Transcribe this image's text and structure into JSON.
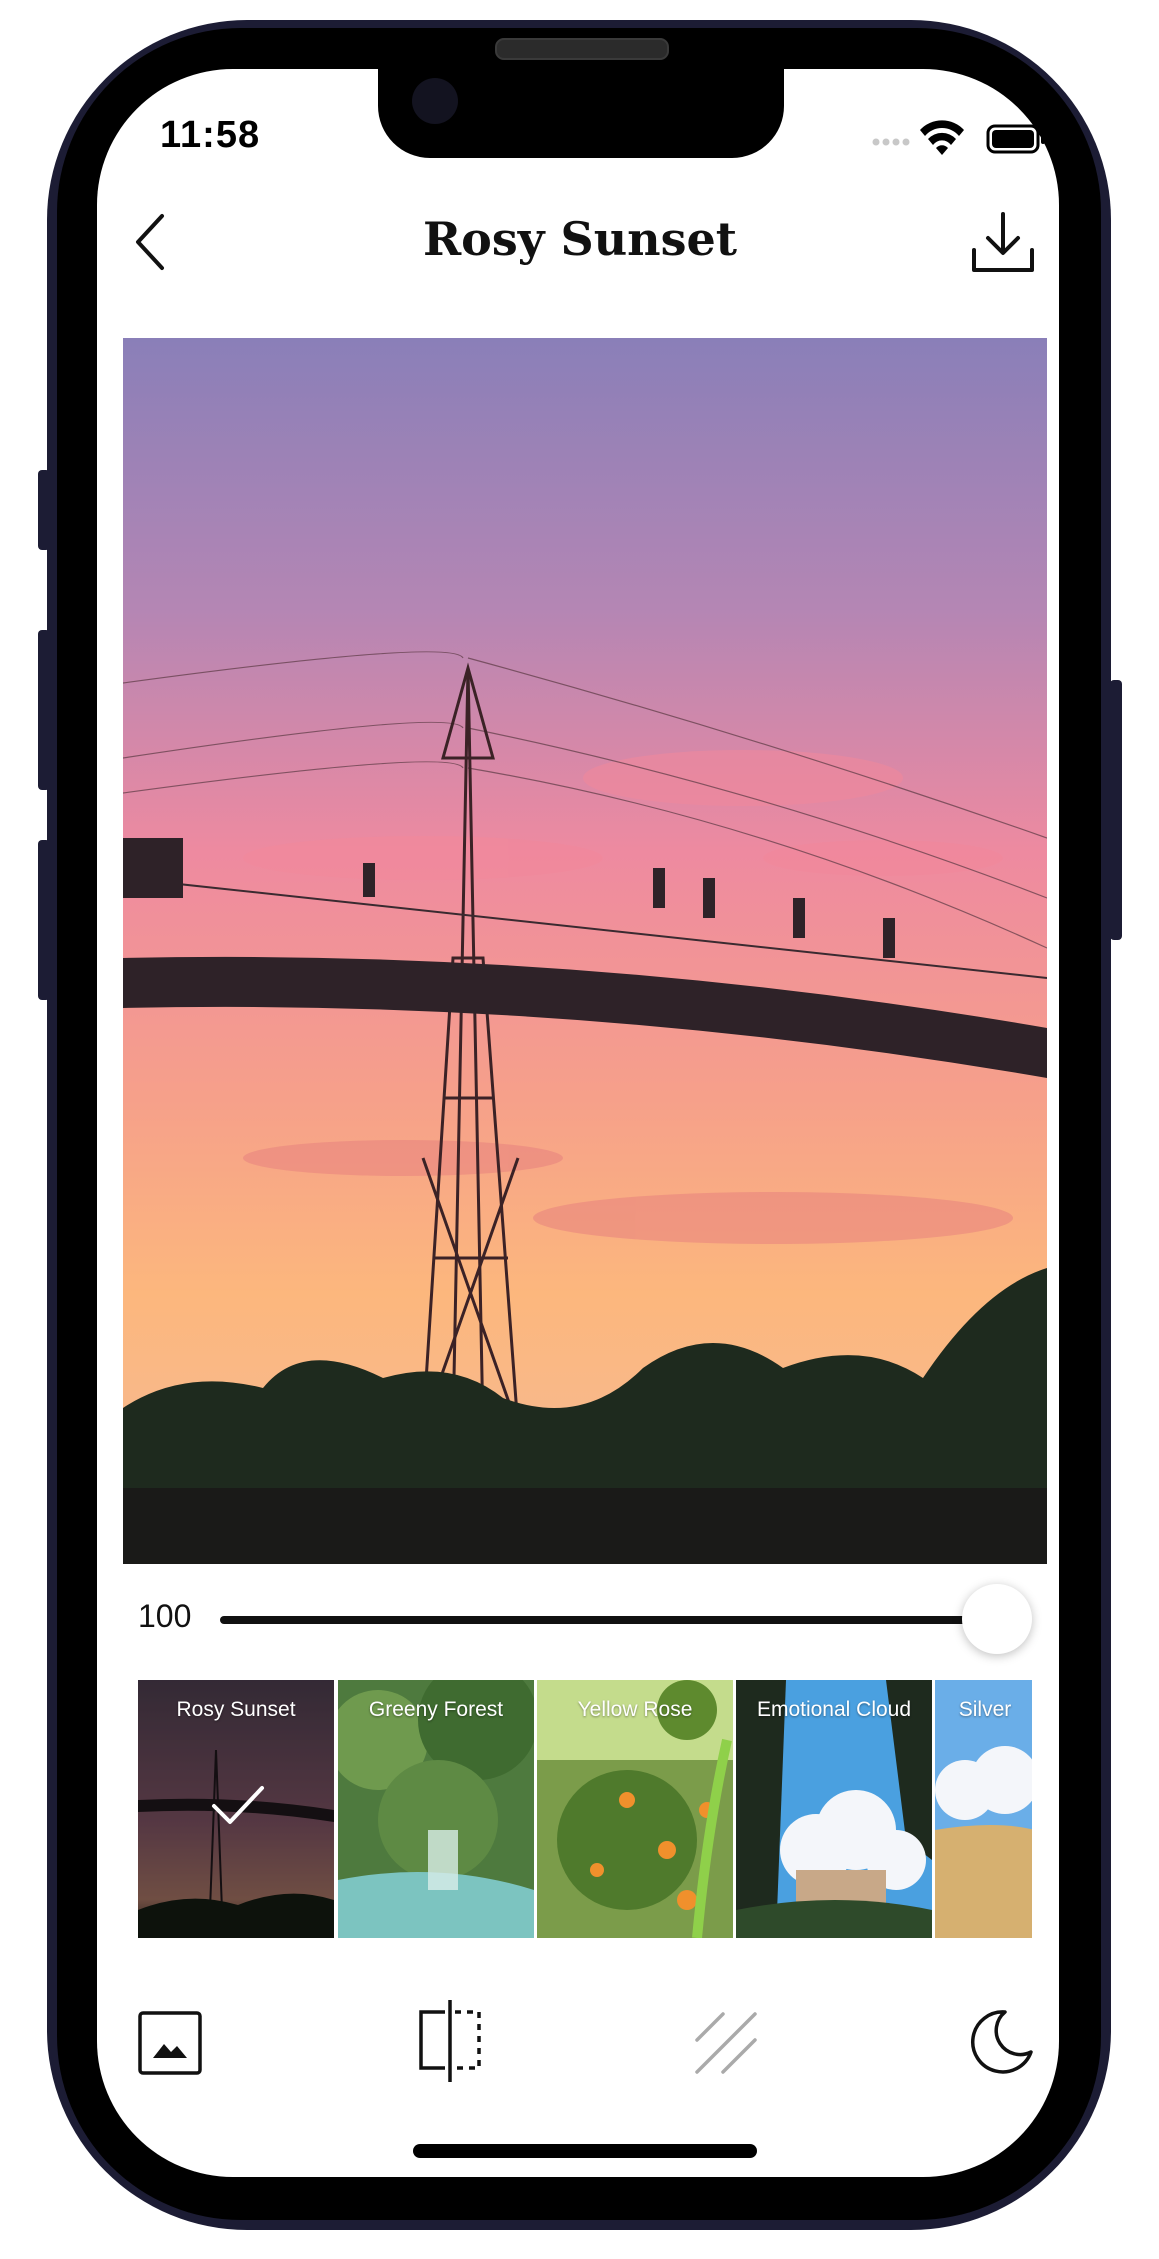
{
  "status_bar": {
    "time": "11:58",
    "icons": [
      "signal-dots-icon",
      "wifi-icon",
      "battery-icon"
    ]
  },
  "nav": {
    "title": "Rosy Sunset",
    "back_icon": "chevron-left-icon",
    "download_icon": "download-icon"
  },
  "slider": {
    "value_label": "100",
    "value": 1.0
  },
  "filters": [
    {
      "label": "Rosy Sunset",
      "selected": true
    },
    {
      "label": "Greeny Forest",
      "selected": false
    },
    {
      "label": "Yellow Rose",
      "selected": false
    },
    {
      "label": "Emotional Cloud",
      "selected": false
    },
    {
      "label": "Silver",
      "selected": false
    }
  ],
  "toolbar": {
    "icons": [
      "image-icon",
      "compare-split-icon",
      "texture-stripes-icon",
      "moon-icon"
    ]
  },
  "colors": {
    "accent": "#111111",
    "phone_frame": "#1c1c34"
  }
}
